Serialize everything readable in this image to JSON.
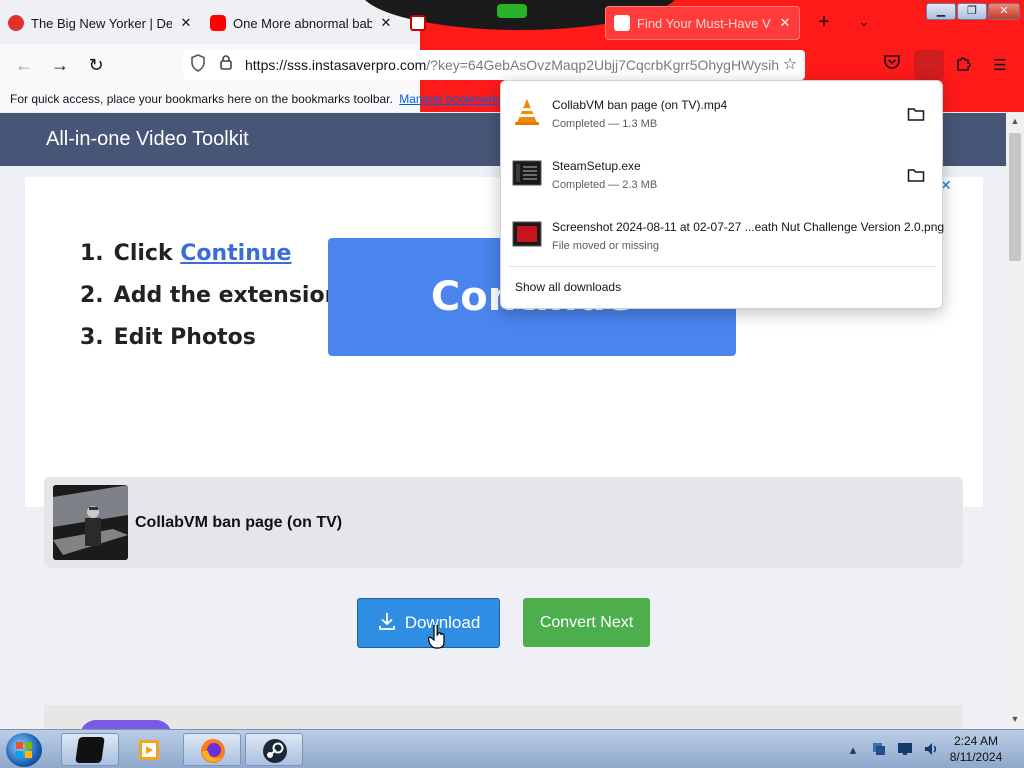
{
  "browser": {
    "tabs": [
      {
        "label": "The Big New Yorker | Deals",
        "close": "✕"
      },
      {
        "label": "One More abnormal baby |",
        "close": "✕"
      },
      {
        "label": "",
        "close": ""
      },
      {
        "label": "Find Your Must-Have Vide",
        "close": "✕"
      }
    ],
    "new_tab": "+",
    "tab_list": "⌄",
    "window_controls": {
      "minimize": "▁",
      "maximize": "❐",
      "close": "✕"
    },
    "url_host": "https://sss.instasaverpro.com",
    "url_rest": "/?key=64GebAsOvzMaqp2Ubjj7CqcrbKgrr5OhygHWysih",
    "bookmarks_bar": {
      "text": "For quick access, place your bookmarks here on the bookmarks toolbar.",
      "link": "Manage bookmarks..."
    },
    "theme_color": "#ff1a1a"
  },
  "page": {
    "header_title": "All-in-one Video Toolkit",
    "ad": {
      "steps": [
        {
          "num": "1.",
          "text": "Click ",
          "link": "Continue"
        },
        {
          "num": "2.",
          "text": "Add the extension",
          "link": ""
        },
        {
          "num": "3.",
          "text": "Edit Photos",
          "link": ""
        }
      ],
      "big_button": "Continue",
      "close": "✕"
    },
    "video": {
      "title": "CollabVM ban page (on TV)"
    },
    "download_button": "Download",
    "convert_button": "Convert Next"
  },
  "downloads_panel": {
    "items": [
      {
        "name": "CollabVM ban page (on TV).mp4",
        "status": "Completed — 1.3 MB",
        "icon": "vlc-cone-icon"
      },
      {
        "name": "SteamSetup.exe",
        "status": "Completed — 2.3 MB",
        "icon": "exe-file-icon"
      },
      {
        "name": "Screenshot 2024-08-11 at 02-07-27 ...eath Nut Challenge Version 2.0.png",
        "status": "File moved or missing",
        "icon": "image-file-icon"
      }
    ],
    "show_all": "Show all downloads"
  },
  "taskbar": {
    "time": "2:24 AM",
    "date": "8/11/2024"
  }
}
